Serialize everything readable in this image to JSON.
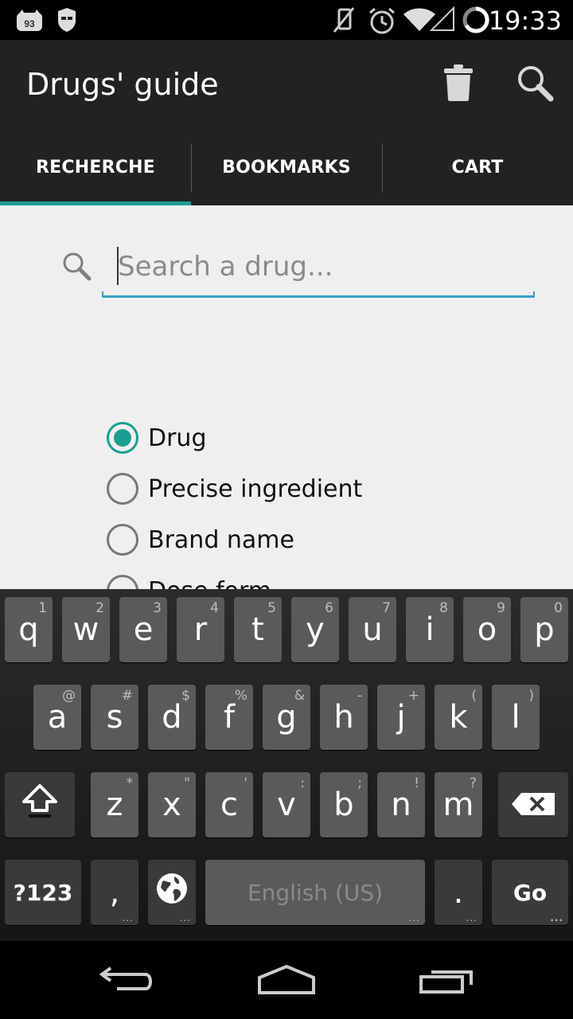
{
  "status_bar": {
    "time": "19:33",
    "notification_badge": "93",
    "icons": [
      "notification-93-icon",
      "incognito-icon",
      "mute-icon",
      "alarm-icon",
      "wifi-icon",
      "signal-icon",
      "battery-icon"
    ]
  },
  "action_bar": {
    "title": "Drugs' guide",
    "actions": [
      "trash-icon",
      "search-icon"
    ]
  },
  "tabs": [
    {
      "label": "RECHERCHE",
      "selected": true
    },
    {
      "label": "BOOKMARKS",
      "selected": false
    },
    {
      "label": "CART",
      "selected": false
    }
  ],
  "search": {
    "placeholder": "Search a drug...",
    "value": ""
  },
  "search_options": [
    {
      "label": "Drug",
      "checked": true
    },
    {
      "label": "Precise ingredient",
      "checked": false
    },
    {
      "label": "Brand name",
      "checked": false
    },
    {
      "label": "Dose form",
      "checked": false
    }
  ],
  "keyboard": {
    "row1": [
      {
        "key": "q",
        "hint": "1"
      },
      {
        "key": "w",
        "hint": "2"
      },
      {
        "key": "e",
        "hint": "3"
      },
      {
        "key": "r",
        "hint": "4"
      },
      {
        "key": "t",
        "hint": "5"
      },
      {
        "key": "y",
        "hint": "6"
      },
      {
        "key": "u",
        "hint": "7"
      },
      {
        "key": "i",
        "hint": "8"
      },
      {
        "key": "o",
        "hint": "9"
      },
      {
        "key": "p",
        "hint": "0"
      }
    ],
    "row2": [
      {
        "key": "a",
        "hint": "@"
      },
      {
        "key": "s",
        "hint": "#"
      },
      {
        "key": "d",
        "hint": "$"
      },
      {
        "key": "f",
        "hint": "%"
      },
      {
        "key": "g",
        "hint": "&"
      },
      {
        "key": "h",
        "hint": "-"
      },
      {
        "key": "j",
        "hint": "+"
      },
      {
        "key": "k",
        "hint": "("
      },
      {
        "key": "l",
        "hint": ")"
      }
    ],
    "row3": [
      {
        "key": "z",
        "hint": "*"
      },
      {
        "key": "x",
        "hint": "\""
      },
      {
        "key": "c",
        "hint": "'"
      },
      {
        "key": "v",
        "hint": ":"
      },
      {
        "key": "b",
        "hint": ";"
      },
      {
        "key": "n",
        "hint": "!"
      },
      {
        "key": "m",
        "hint": "?"
      }
    ],
    "symbols_label": "?123",
    "comma": ",",
    "space_label": "English (US)",
    "period": ".",
    "go_label": "Go",
    "shift_icon": "shift-icon",
    "backspace_icon": "backspace-icon",
    "language_icon": "globe-icon"
  },
  "nav_bar": {
    "icons": [
      "back-icon",
      "home-icon",
      "recents-icon"
    ]
  },
  "colors": {
    "accent": "#1a9e90",
    "search_underline": "#33a3c9",
    "action_bar": "#222222",
    "content_bg": "#efefef"
  }
}
